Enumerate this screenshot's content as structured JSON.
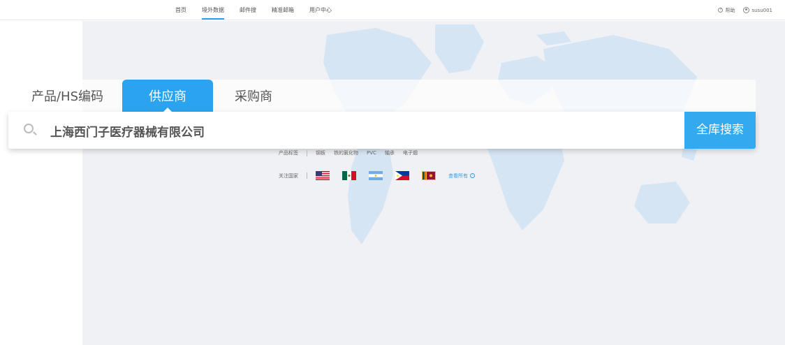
{
  "nav": {
    "items": [
      {
        "label": "首页"
      },
      {
        "label": "境外数据"
      },
      {
        "label": "邮件搜"
      },
      {
        "label": "精准邮箱"
      },
      {
        "label": "用户中心"
      }
    ],
    "active_index": 1,
    "help_label": "帮助",
    "username": "susu001"
  },
  "search": {
    "tabs": [
      {
        "label": "产品/HS编码"
      },
      {
        "label": "供应商"
      },
      {
        "label": "采购商"
      }
    ],
    "active_tab": 1,
    "query": "上海西门子医疗器械有限公司",
    "button_label": "全库搜索"
  },
  "product_tags": {
    "label": "产品标签",
    "items": [
      "钢板",
      "铁的氯化物",
      "PVC",
      "轴承",
      "电子烟"
    ]
  },
  "countries": {
    "label": "关注国家",
    "flags": [
      {
        "icon": "usa-flag-icon"
      },
      {
        "icon": "mexico-flag-icon"
      },
      {
        "icon": "argentina-flag-icon"
      },
      {
        "icon": "philippines-flag-icon"
      },
      {
        "icon": "sri-lanka-flag-icon"
      }
    ],
    "view_all": "查看所有"
  },
  "colors": {
    "accent": "#2ba3ee",
    "background": "#f0f1f5",
    "map": "#d6e5f4"
  }
}
